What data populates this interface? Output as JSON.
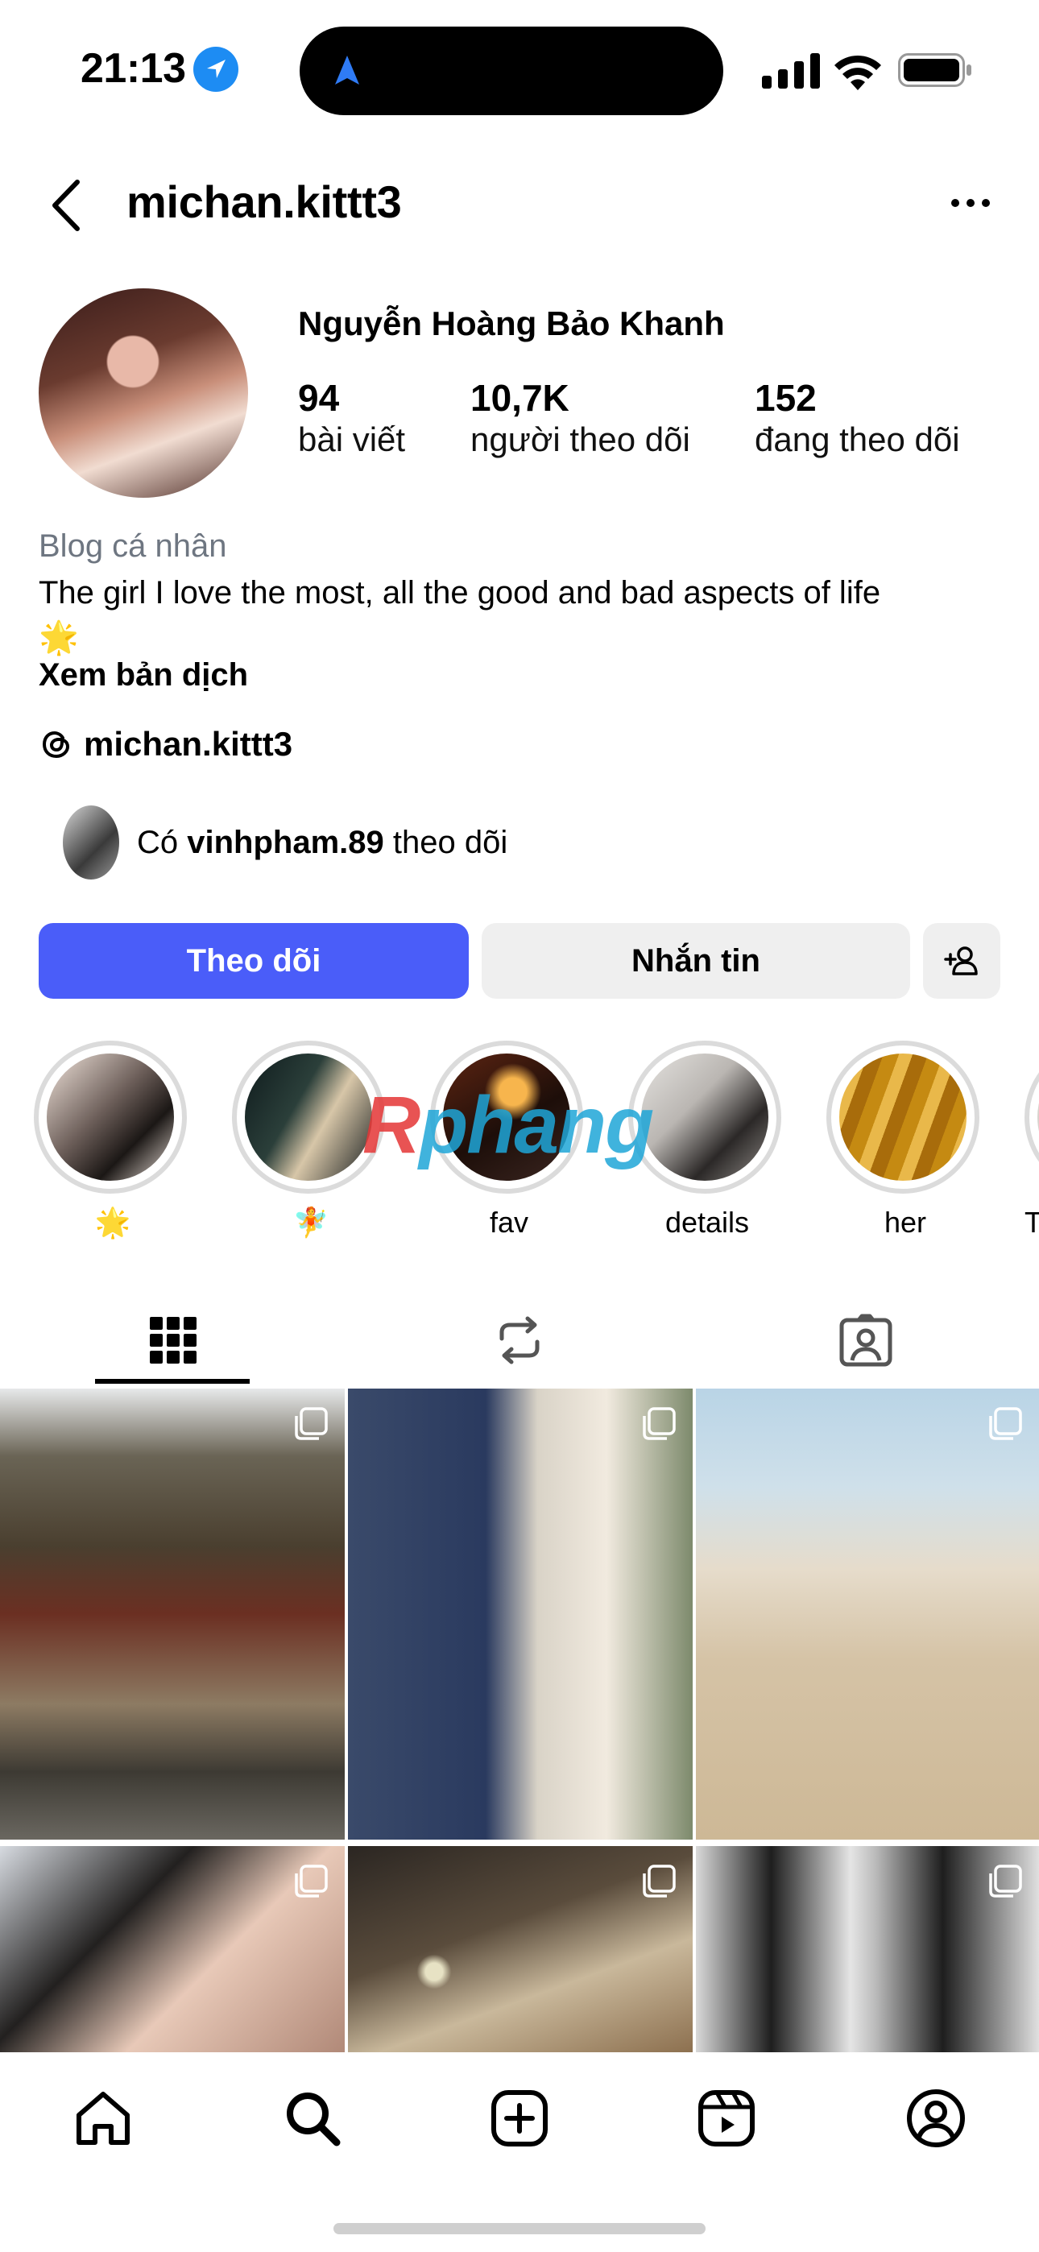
{
  "status_bar": {
    "time": "21:13",
    "icons": [
      "location-arrow-icon",
      "cellular-signal-icon",
      "wifi-icon",
      "battery-icon"
    ]
  },
  "header": {
    "username": "michan.kittt3",
    "back_icon": "chevron-left-icon",
    "menu_icon": "more-horizontal-icon"
  },
  "profile": {
    "full_name": "Nguyễn Hoàng Bảo Khanh",
    "stats": [
      {
        "value": "94",
        "label": "bài viết"
      },
      {
        "value": "10,7K",
        "label": "người theo dõi"
      },
      {
        "value": "152",
        "label": "đang theo dõi"
      }
    ],
    "category": "Blog cá nhân",
    "bio": "The girl I love the most, all the good and bad aspects of life",
    "bio_emoji": "🌟",
    "translate_label": "Xem bản dịch",
    "threads_handle": "michan.kittt3",
    "mutual": {
      "prefix": "Có",
      "user": "vinhpham.89",
      "suffix": "theo dõi"
    }
  },
  "actions": {
    "follow_label": "Theo dõi",
    "message_label": "Nhắn tin",
    "add_icon": "add-user-icon"
  },
  "highlights": [
    {
      "label": "🌟"
    },
    {
      "label": "🧚"
    },
    {
      "label": "fav"
    },
    {
      "label": "details"
    },
    {
      "label": "her"
    },
    {
      "label": "T"
    }
  ],
  "watermark": {
    "part1": "R",
    "part2": "phang"
  },
  "tabs": [
    {
      "name": "grid-icon",
      "active": true
    },
    {
      "name": "reposts-icon",
      "active": false
    },
    {
      "name": "tagged-icon",
      "active": false
    }
  ],
  "bottom_nav": [
    "home-icon",
    "search-icon",
    "create-icon",
    "reels-icon",
    "profile-icon"
  ],
  "colors": {
    "follow_button": "#4a5df9",
    "secondary_button": "#efefef",
    "location_badge": "#1d8cf3",
    "muted_text": "#6e7681"
  }
}
